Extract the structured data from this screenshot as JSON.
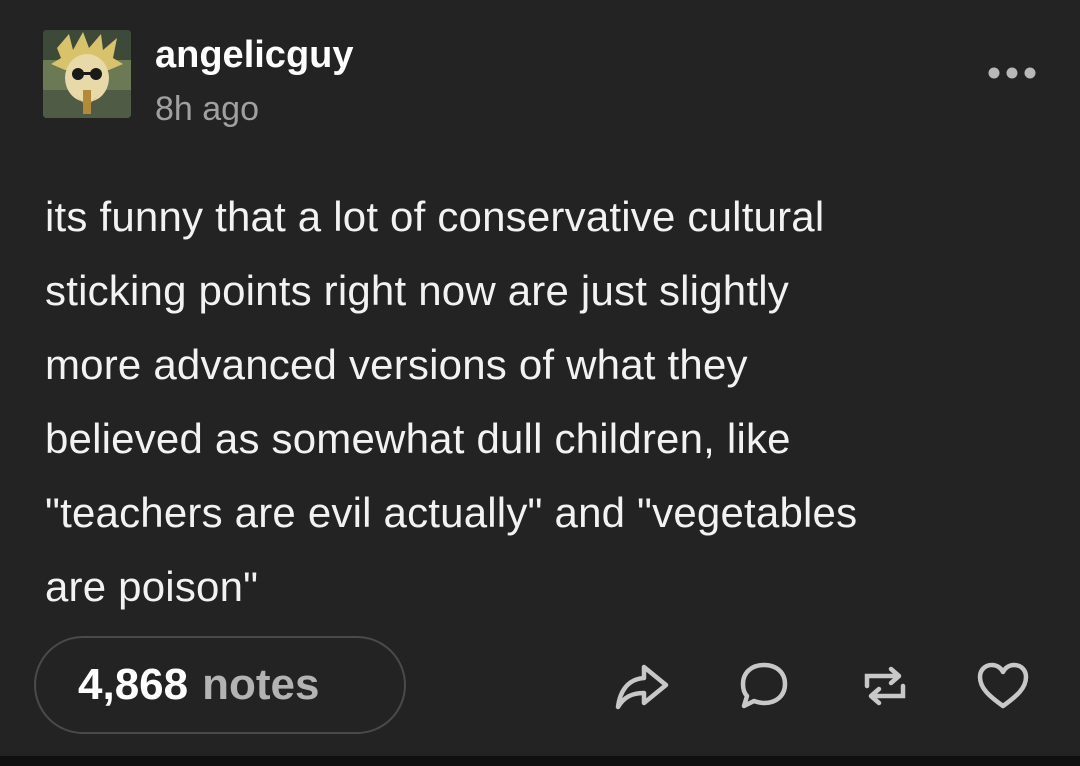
{
  "post": {
    "author": "angelicguy",
    "timestamp": "8h ago",
    "body": [
      "its funny that a lot of conservative cultural",
      "sticking points right now are just slightly",
      "more advanced versions of what they",
      "believed as somewhat dull children, like",
      "\"teachers are evil actually\" and \"vegetables",
      "are poison\""
    ],
    "notes_count": "4,868",
    "notes_label": "notes"
  },
  "icons": {
    "more": "more-horizontal-icon",
    "share": "share-icon",
    "reply": "reply-icon",
    "reblog": "reblog-icon",
    "like": "heart-icon"
  },
  "colors": {
    "background": "#232323",
    "text": "#ffffff",
    "muted": "#a0a0a0",
    "pill_border": "#4a4a4a"
  }
}
